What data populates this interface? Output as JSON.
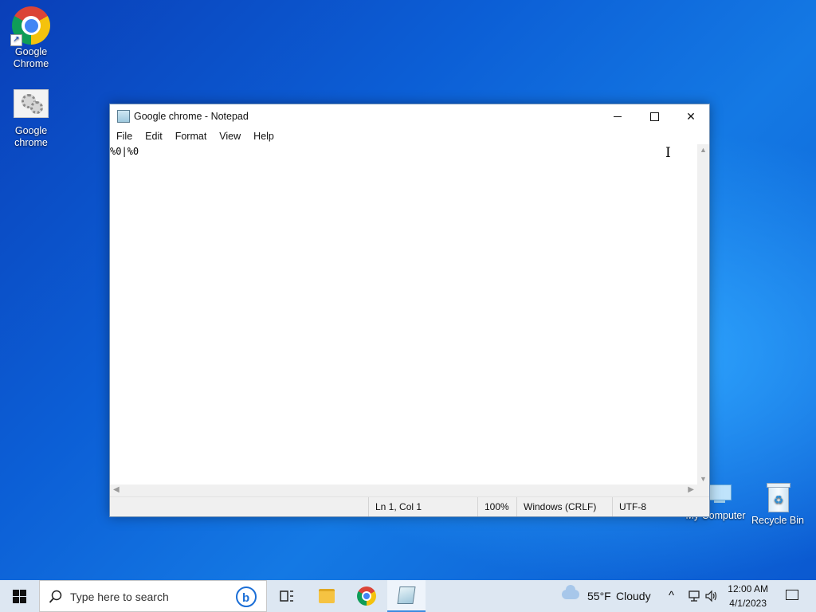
{
  "desktop": {
    "icons": [
      {
        "label_line1": "Google",
        "label_line2": "Chrome"
      },
      {
        "label_line1": "Google",
        "label_line2": "chrome"
      },
      {
        "label": "My Computer"
      },
      {
        "label": "Recycle Bin"
      }
    ]
  },
  "notepad": {
    "title": "Google chrome - Notepad",
    "menu": [
      "File",
      "Edit",
      "Format",
      "View",
      "Help"
    ],
    "content": "%0|%0",
    "status": {
      "position": "Ln 1, Col 1",
      "zoom": "100%",
      "line_endings": "Windows (CRLF)",
      "encoding": "UTF-8"
    },
    "window_controls": {
      "close": "✕"
    }
  },
  "taskbar": {
    "search_placeholder": "Type here to search",
    "weather": {
      "temp": "55°F",
      "condition": "Cloudy"
    },
    "clock": {
      "time": "12:00 AM",
      "date": "4/1/2023"
    },
    "tray_chevron": "^"
  }
}
